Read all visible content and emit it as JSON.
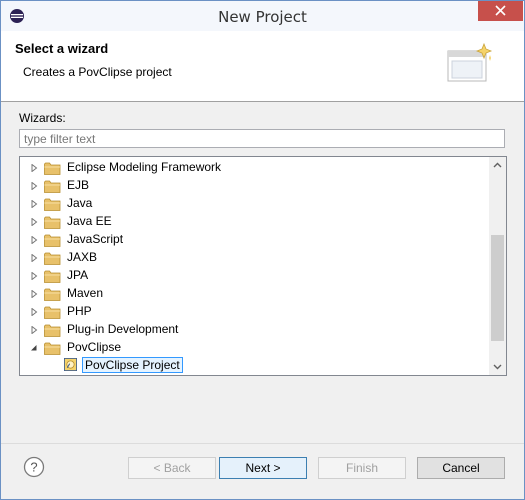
{
  "window": {
    "title": "New Project"
  },
  "banner": {
    "title": "Select a wizard",
    "description": "Creates a PovClipse project"
  },
  "wizards": {
    "label": "Wizards:",
    "filter_placeholder": "type filter text",
    "items": [
      {
        "label": "Eclipse Modeling Framework",
        "expanded": false
      },
      {
        "label": "EJB",
        "expanded": false
      },
      {
        "label": "Java",
        "expanded": false
      },
      {
        "label": "Java EE",
        "expanded": false
      },
      {
        "label": "JavaScript",
        "expanded": false
      },
      {
        "label": "JAXB",
        "expanded": false
      },
      {
        "label": "JPA",
        "expanded": false
      },
      {
        "label": "Maven",
        "expanded": false
      },
      {
        "label": "PHP",
        "expanded": false
      },
      {
        "label": "Plug-in Development",
        "expanded": false
      },
      {
        "label": "PovClipse",
        "expanded": true
      },
      {
        "label": "PovClipse Project",
        "selected": true
      }
    ]
  },
  "buttons": {
    "back": "< Back",
    "next": "Next >",
    "finish": "Finish",
    "cancel": "Cancel"
  },
  "colors": {
    "accent": "#3399ff",
    "close": "#c7504b",
    "folder": "#e8c16a"
  }
}
